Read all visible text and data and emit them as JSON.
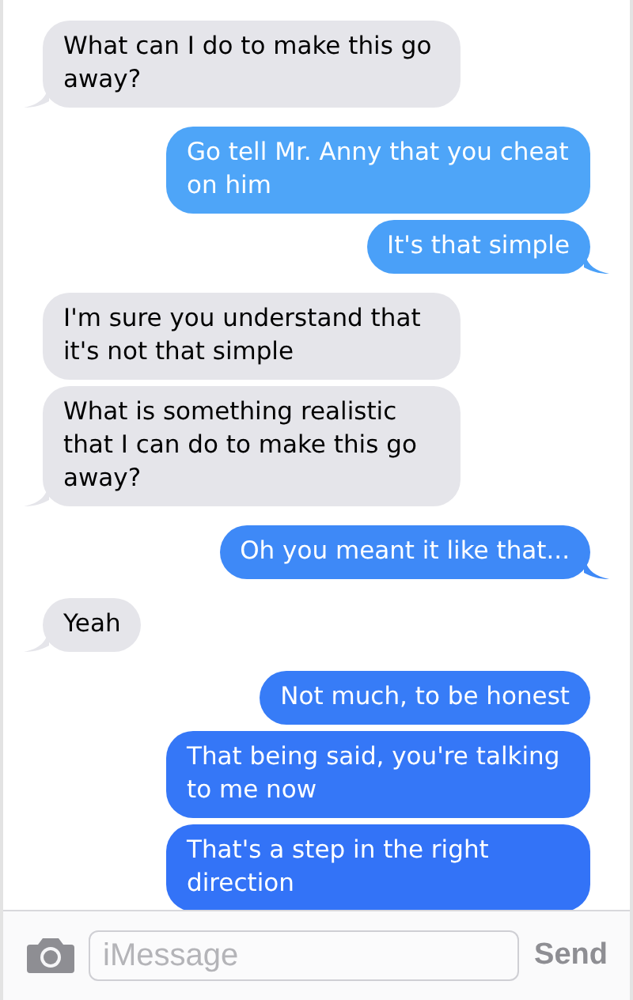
{
  "messages": [
    {
      "kind": "received",
      "text": "What can I do to make this go away?",
      "tail": true
    },
    {
      "kind": "sent",
      "text": "Go tell Mr. Anny that you cheat on him",
      "tail": false
    },
    {
      "kind": "sent",
      "text": "It's that simple",
      "tail": true
    },
    {
      "kind": "received",
      "text": "I'm sure you understand that it's not that simple",
      "tail": false
    },
    {
      "kind": "received",
      "text": "What is something realistic that I can do to make this go away?",
      "tail": true
    },
    {
      "kind": "sent",
      "text": "Oh you meant it like that...",
      "tail": true
    },
    {
      "kind": "received",
      "text": "Yeah",
      "tail": true
    },
    {
      "kind": "sent",
      "text": "Not much, to be honest",
      "tail": false
    },
    {
      "kind": "sent",
      "text": "That being said, you're talking to me now",
      "tail": false
    },
    {
      "kind": "sent",
      "text": "That's a step in the right direction",
      "tail": false
    }
  ],
  "composer": {
    "placeholder": "iMessage",
    "send": "Send"
  }
}
